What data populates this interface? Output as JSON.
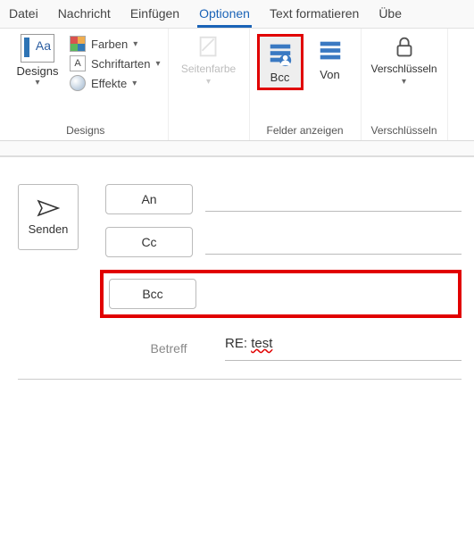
{
  "tabs": {
    "file": "Datei",
    "message": "Nachricht",
    "insert": "Einfügen",
    "options": "Optionen",
    "format": "Text formatieren",
    "review": "Übe"
  },
  "ribbon": {
    "designs": {
      "big": "Designs",
      "colors": "Farben",
      "fonts": "Schriftarten",
      "effects": "Effekte",
      "group_label": "Designs"
    },
    "pagecolor": "Seitenfarbe",
    "show_fields": {
      "bcc": "Bcc",
      "from": "Von",
      "group_label": "Felder anzeigen"
    },
    "encrypt": {
      "label": "Verschlüsseln",
      "group_label": "Verschlüsseln"
    }
  },
  "compose": {
    "send": "Senden",
    "to": "An",
    "cc": "Cc",
    "bcc": "Bcc",
    "subject_label": "Betreff",
    "subject_value_prefix": "RE: ",
    "subject_value_word": "test"
  }
}
